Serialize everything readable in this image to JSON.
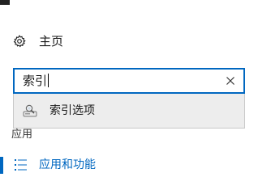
{
  "nav": {
    "home_label": "主页",
    "section_label": "应用",
    "selected_item_label": "应用和功能"
  },
  "search": {
    "value": "索引",
    "suggestion_label": "索引选项"
  },
  "icons": {
    "home": "gear-icon",
    "clear": "close-icon",
    "suggestion": "indexing-options-icon",
    "apps": "list-icon"
  },
  "colors": {
    "accent": "#0067c0",
    "suggestion_background": "#ededed"
  }
}
